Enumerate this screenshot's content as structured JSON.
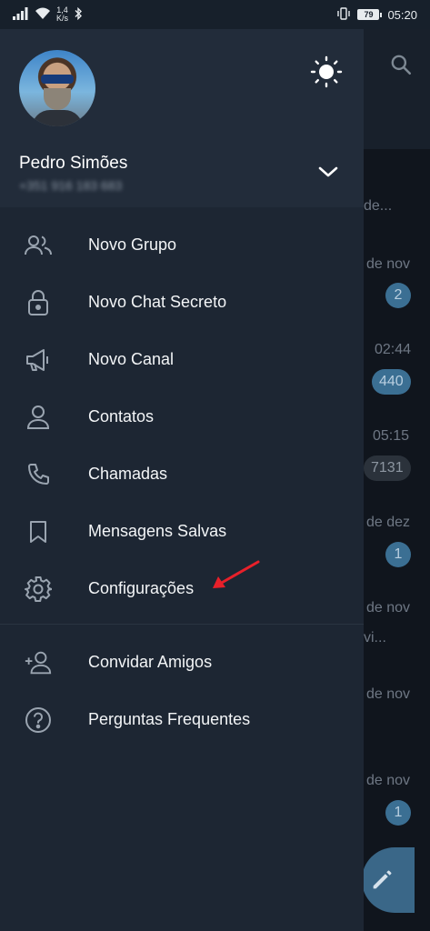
{
  "status_bar": {
    "network_speed": "1,4\nK/s",
    "battery": "79",
    "time": "05:20"
  },
  "background_chats": {
    "items": [
      {
        "snippet": "de...",
        "badge": ""
      },
      {
        "date": "de nov",
        "badge": "2",
        "muted": false
      },
      {
        "date": "02:44",
        "badge": "440",
        "muted": false
      },
      {
        "date": "05:15",
        "badge": "7131",
        "muted": true
      },
      {
        "date": "de dez",
        "badge": "1",
        "muted": false
      },
      {
        "date": "de nov",
        "snippet": "vi...",
        "badge": ""
      },
      {
        "date": "de nov",
        "badge": ""
      },
      {
        "date": "de nov",
        "badge": "1",
        "muted": false
      }
    ]
  },
  "drawer": {
    "user": {
      "name": "Pedro Simões",
      "phone": "+351 916 183 683"
    },
    "menu": [
      {
        "label": "Novo Grupo",
        "icon": "group-icon"
      },
      {
        "label": "Novo Chat Secreto",
        "icon": "lock-icon"
      },
      {
        "label": "Novo Canal",
        "icon": "megaphone-icon"
      },
      {
        "label": "Contatos",
        "icon": "person-icon"
      },
      {
        "label": "Chamadas",
        "icon": "phone-icon"
      },
      {
        "label": "Mensagens Salvas",
        "icon": "bookmark-icon"
      },
      {
        "label": "Configurações",
        "icon": "gear-icon"
      }
    ],
    "menu_secondary": [
      {
        "label": "Convidar Amigos",
        "icon": "add-person-icon"
      },
      {
        "label": "Perguntas Frequentes",
        "icon": "help-icon"
      }
    ]
  },
  "colors": {
    "drawer_bg": "#1d2633",
    "header_bg": "#222c3a",
    "annotation_arrow": "#e8202a",
    "badge": "#3b6f93"
  }
}
